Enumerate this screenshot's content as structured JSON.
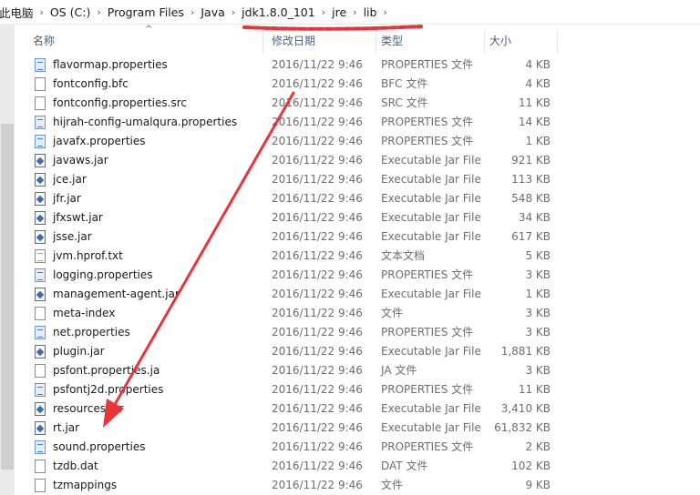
{
  "breadcrumb": [
    "此电脑",
    "OS (C:)",
    "Program Files",
    "Java",
    "jdk1.8.0_101",
    "jre",
    "lib"
  ],
  "breadcrumb_separator": "›",
  "columns": {
    "name": "名称",
    "modified": "修改日期",
    "type": "类型",
    "size": "大小"
  },
  "annotation_color": "#e8353a",
  "files": [
    {
      "name": "flavormap.properties",
      "date": "2016/11/22 9:46",
      "type": "PROPERTIES 文件",
      "size": "4 KB",
      "icon": "properties-file-icon"
    },
    {
      "name": "fontconfig.bfc",
      "date": "2016/11/22 9:46",
      "type": "BFC 文件",
      "size": "4 KB",
      "icon": "file-icon"
    },
    {
      "name": "fontconfig.properties.src",
      "date": "2016/11/22 9:46",
      "type": "SRC 文件",
      "size": "11 KB",
      "icon": "file-icon"
    },
    {
      "name": "hijrah-config-umalqura.properties",
      "date": "2016/11/22 9:46",
      "type": "PROPERTIES 文件",
      "size": "14 KB",
      "icon": "properties-file-icon"
    },
    {
      "name": "javafx.properties",
      "date": "2016/11/22 9:46",
      "type": "PROPERTIES 文件",
      "size": "1 KB",
      "icon": "properties-file-icon"
    },
    {
      "name": "javaws.jar",
      "date": "2016/11/22 9:46",
      "type": "Executable Jar File",
      "size": "921 KB",
      "icon": "jar-file-icon"
    },
    {
      "name": "jce.jar",
      "date": "2016/11/22 9:46",
      "type": "Executable Jar File",
      "size": "113 KB",
      "icon": "jar-file-icon"
    },
    {
      "name": "jfr.jar",
      "date": "2016/11/22 9:46",
      "type": "Executable Jar File",
      "size": "548 KB",
      "icon": "jar-file-icon"
    },
    {
      "name": "jfxswt.jar",
      "date": "2016/11/22 9:46",
      "type": "Executable Jar File",
      "size": "34 KB",
      "icon": "jar-file-icon"
    },
    {
      "name": "jsse.jar",
      "date": "2016/11/22 9:46",
      "type": "Executable Jar File",
      "size": "617 KB",
      "icon": "jar-file-icon"
    },
    {
      "name": "jvm.hprof.txt",
      "date": "2016/11/22 9:46",
      "type": "文本文档",
      "size": "5 KB",
      "icon": "text-file-icon"
    },
    {
      "name": "logging.properties",
      "date": "2016/11/22 9:46",
      "type": "PROPERTIES 文件",
      "size": "3 KB",
      "icon": "properties-file-icon"
    },
    {
      "name": "management-agent.jar",
      "date": "2016/11/22 9:46",
      "type": "Executable Jar File",
      "size": "1 KB",
      "icon": "jar-file-icon"
    },
    {
      "name": "meta-index",
      "date": "2016/11/22 9:46",
      "type": "文件",
      "size": "3 KB",
      "icon": "file-icon"
    },
    {
      "name": "net.properties",
      "date": "2016/11/22 9:46",
      "type": "PROPERTIES 文件",
      "size": "3 KB",
      "icon": "properties-file-icon"
    },
    {
      "name": "plugin.jar",
      "date": "2016/11/22 9:46",
      "type": "Executable Jar File",
      "size": "1,881 KB",
      "icon": "jar-file-icon"
    },
    {
      "name": "psfont.properties.ja",
      "date": "2016/11/22 9:46",
      "type": "JA 文件",
      "size": "3 KB",
      "icon": "file-icon"
    },
    {
      "name": "psfontj2d.properties",
      "date": "2016/11/22 9:46",
      "type": "PROPERTIES 文件",
      "size": "11 KB",
      "icon": "properties-file-icon"
    },
    {
      "name": "resources.jar",
      "date": "2016/11/22 9:46",
      "type": "Executable Jar File",
      "size": "3,410 KB",
      "icon": "jar-file-icon"
    },
    {
      "name": "rt.jar",
      "date": "2016/11/22 9:46",
      "type": "Executable Jar File",
      "size": "61,832 KB",
      "icon": "jar-file-icon"
    },
    {
      "name": "sound.properties",
      "date": "2016/11/22 9:46",
      "type": "PROPERTIES 文件",
      "size": "2 KB",
      "icon": "properties-file-icon"
    },
    {
      "name": "tzdb.dat",
      "date": "2016/11/22 9:46",
      "type": "DAT 文件",
      "size": "102 KB",
      "icon": "file-icon"
    },
    {
      "name": "tzmappings",
      "date": "2016/11/22 9:46",
      "type": "文件",
      "size": "9 KB",
      "icon": "file-icon"
    }
  ]
}
